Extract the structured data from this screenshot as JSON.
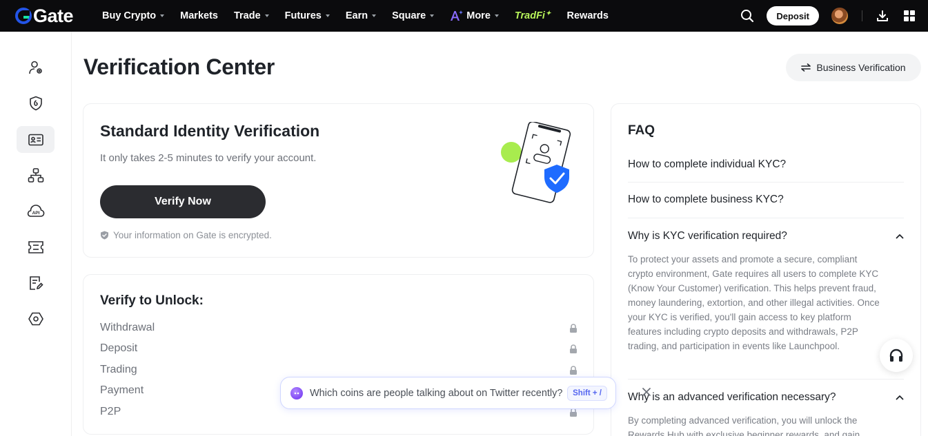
{
  "brand": {
    "name": "Gate",
    "logo_icon": "gate-logo-icon"
  },
  "nav": {
    "items": [
      {
        "label": "Buy Crypto",
        "dropdown": true
      },
      {
        "label": "Markets",
        "dropdown": false
      },
      {
        "label": "Trade",
        "dropdown": true
      },
      {
        "label": "Futures",
        "dropdown": true
      },
      {
        "label": "Earn",
        "dropdown": true
      },
      {
        "label": "Square",
        "dropdown": true
      },
      {
        "label": "More",
        "dropdown": true,
        "icon": "ai-sparkle-icon"
      },
      {
        "label": "TradFi",
        "dropdown": false,
        "color": "#b7f35a"
      },
      {
        "label": "Rewards",
        "dropdown": false
      }
    ],
    "deposit_label": "Deposit",
    "icons": [
      "search-icon",
      "avatar",
      "download-icon",
      "grid-icon"
    ]
  },
  "sidebar": {
    "items": [
      {
        "name": "profile",
        "icon": "user-settings-icon",
        "active": false
      },
      {
        "name": "security",
        "icon": "shield-icon",
        "active": false
      },
      {
        "name": "verification",
        "icon": "id-card-icon",
        "active": true
      },
      {
        "name": "sub-accounts",
        "icon": "hierarchy-icon",
        "active": false
      },
      {
        "name": "api",
        "icon": "api-icon",
        "active": false
      },
      {
        "name": "vouchers",
        "icon": "ticket-icon",
        "active": false
      },
      {
        "name": "records",
        "icon": "document-edit-icon",
        "active": false
      },
      {
        "name": "settings",
        "icon": "hexagon-settings-icon",
        "active": false
      }
    ]
  },
  "header": {
    "title": "Verification Center",
    "business_button": "Business Verification"
  },
  "standard": {
    "title": "Standard Identity Verification",
    "subtitle": "It only takes 2-5 minutes to verify your account.",
    "button": "Verify Now",
    "encrypted_note": "Your information on Gate is encrypted."
  },
  "unlock": {
    "title": "Verify to Unlock:",
    "items": [
      "Withdrawal",
      "Deposit",
      "Trading",
      "Payment",
      "P2P"
    ]
  },
  "faq": {
    "title": "FAQ",
    "q1": "How to complete individual KYC?",
    "q2": "How to complete business KYC?",
    "q3": "Why is KYC verification required?",
    "a3": "To protect your assets and promote a secure, compliant crypto environment, Gate requires all users to complete KYC (Know Your Customer) verification. This helps prevent fraud, money laundering, extortion, and other illegal activities. Once your KYC is verified, you'll gain access to key platform features including crypto deposits and withdrawals, P2P trading, and participation in events like Launchpool.",
    "q4": "Why is an advanced verification necessary?",
    "a4": "By completing advanced verification, you will unlock the Rewards Hub with exclusive beginner rewards, and gain"
  },
  "assistant": {
    "prompt": "Which coins are people talking about on Twitter recently?",
    "shortcut": "Shift + /"
  },
  "colors": {
    "accent_blue": "#1e6bff",
    "accent_green": "#a8ec4e",
    "dark_button": "#2b2c30"
  }
}
